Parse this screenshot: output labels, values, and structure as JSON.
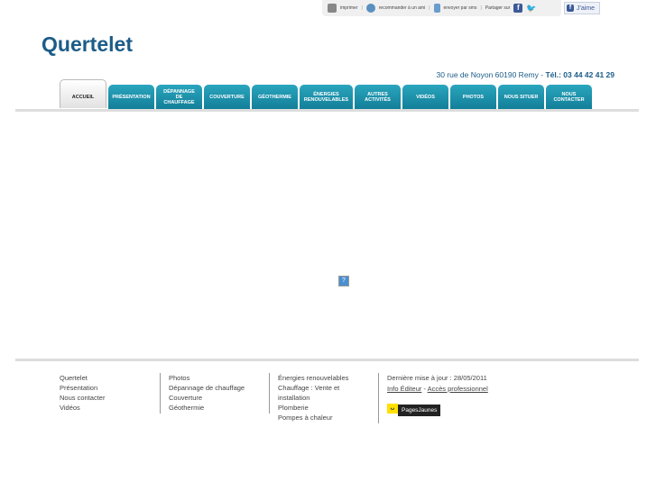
{
  "share": {
    "print": "imprimer",
    "recommend": "recommander à un ami",
    "sms": "envoyer par sms",
    "share_on": "Partager sur",
    "like": "J'aime"
  },
  "logo": "Quertelet",
  "address": "30 rue de Noyon 60190 Remy",
  "tel_sep": " - ",
  "phone": "Tél.: 03 44 42 41 29",
  "nav": [
    "ACCUEIL",
    "PRÉSENTATION",
    "DÉPANNAGE\nDE\nCHAUFFAGE",
    "COUVERTURE",
    "GÉOTHERMIE",
    "ÉNERGIES\nRENOUVELABLES",
    "AUTRES\nACTIVITÉS",
    "VIDÉOS",
    "PHOTOS",
    "NOUS SITUER",
    "NOUS\nCONTACTER"
  ],
  "footer": {
    "col1": [
      "Quertelet",
      "Présentation",
      "Nous contacter",
      "Vidéos"
    ],
    "col2": [
      "Photos",
      "Dépannage de chauffage",
      "Couverture",
      "Géothermie"
    ],
    "col3": [
      "Énergies renouvelables",
      "Chauffage : Vente et installation",
      "Plomberie",
      "Pompes à chaleur"
    ],
    "updated": "Dernière mise à jour : 28/05/2011",
    "info": "Info Éditeur",
    "dash": " - ",
    "pro": "Accès professionnel",
    "pj": "PagesJaunes"
  }
}
